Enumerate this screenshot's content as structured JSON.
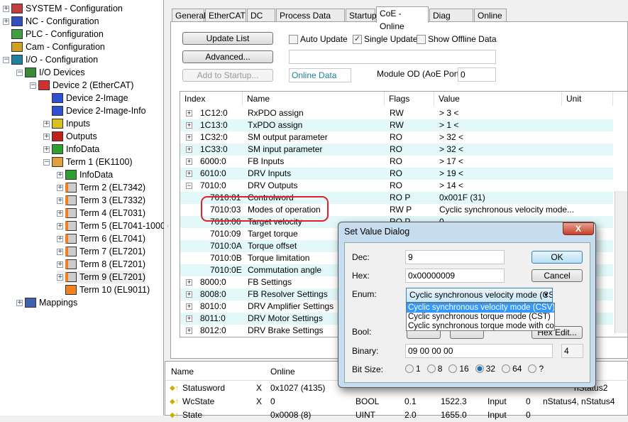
{
  "tree": [
    {
      "label": "SYSTEM - Configuration",
      "toggle": "+",
      "depth": 0,
      "icon": "system-icon"
    },
    {
      "label": "NC - Configuration",
      "toggle": "+",
      "depth": 0,
      "icon": "nc-icon"
    },
    {
      "label": "PLC - Configuration",
      "toggle": "",
      "depth": 0,
      "icon": "plc-icon"
    },
    {
      "label": "Cam - Configuration",
      "toggle": "",
      "depth": 0,
      "icon": "cam-icon"
    },
    {
      "label": "I/O - Configuration",
      "toggle": "-",
      "depth": 0,
      "icon": "io-icon"
    },
    {
      "label": "I/O Devices",
      "toggle": "-",
      "depth": 1,
      "icon": "io-devices-icon"
    },
    {
      "label": "Device 2 (EtherCAT)",
      "toggle": "-",
      "depth": 2,
      "icon": "ethercat-device-icon"
    },
    {
      "label": "Device 2-Image",
      "toggle": "",
      "depth": 3,
      "icon": "image-icon"
    },
    {
      "label": "Device 2-Image-Info",
      "toggle": "",
      "depth": 3,
      "icon": "image-icon"
    },
    {
      "label": "Inputs",
      "toggle": "+",
      "depth": 3,
      "icon": "inputs-icon"
    },
    {
      "label": "Outputs",
      "toggle": "+",
      "depth": 3,
      "icon": "outputs-icon"
    },
    {
      "label": "InfoData",
      "toggle": "+",
      "depth": 3,
      "icon": "infodata-icon"
    },
    {
      "label": "Term 1 (EK1100)",
      "toggle": "-",
      "depth": 3,
      "icon": "coupler-icon"
    },
    {
      "label": "InfoData",
      "toggle": "+",
      "depth": 4,
      "icon": "infodata-icon"
    },
    {
      "label": "Term 2 (EL7342)",
      "toggle": "+",
      "depth": 4,
      "icon": "terminal-icon"
    },
    {
      "label": "Term 3 (EL7332)",
      "toggle": "+",
      "depth": 4,
      "icon": "terminal-icon"
    },
    {
      "label": "Term 4 (EL7031)",
      "toggle": "+",
      "depth": 4,
      "icon": "terminal-icon"
    },
    {
      "label": "Term 5 (EL7041-1000)",
      "toggle": "+",
      "depth": 4,
      "icon": "terminal-icon"
    },
    {
      "label": "Term 6 (EL7041)",
      "toggle": "+",
      "depth": 4,
      "icon": "terminal-icon"
    },
    {
      "label": "Term 7 (EL7201)",
      "toggle": "+",
      "depth": 4,
      "icon": "terminal-icon"
    },
    {
      "label": "Term 8 (EL7201)",
      "toggle": "+",
      "depth": 4,
      "icon": "terminal-icon"
    },
    {
      "label": "Term 9 (EL7201)",
      "toggle": "+",
      "depth": 4,
      "icon": "terminal-icon",
      "selected": true
    },
    {
      "label": "Term 10 (EL9011)",
      "toggle": "",
      "depth": 4,
      "icon": "end-terminal-icon"
    },
    {
      "label": "Mappings",
      "toggle": "+",
      "depth": 1,
      "icon": "mappings-icon"
    }
  ],
  "tabs": [
    "General",
    "EtherCAT",
    "DC",
    "Process Data",
    "Startup",
    "CoE - Online",
    "Diag History",
    "Online"
  ],
  "active_tab": "CoE - Online",
  "coe": {
    "update_list": "Update List",
    "advanced": "Advanced...",
    "add_to_startup": "Add to Startup...",
    "auto_update": "Auto Update",
    "auto_update_checked": false,
    "single_update": "Single Update",
    "single_update_checked": true,
    "show_offline": "Show Offline Data",
    "show_offline_checked": false,
    "online_data": "Online Data",
    "module_od_label": "Module OD (AoE Port):",
    "module_od_value": "0",
    "columns": [
      "Index",
      "Name",
      "Flags",
      "Value",
      "Unit"
    ],
    "rows": [
      {
        "index": "1C12:0",
        "name": "RxPDO assign",
        "flags": "RW",
        "value": "> 3 <",
        "toggle": "+"
      },
      {
        "index": "1C13:0",
        "name": "TxPDO assign",
        "flags": "RW",
        "value": "> 1 <",
        "toggle": "+"
      },
      {
        "index": "1C32:0",
        "name": "SM output parameter",
        "flags": "RO",
        "value": "> 32 <",
        "toggle": "+"
      },
      {
        "index": "1C33:0",
        "name": "SM input parameter",
        "flags": "RO",
        "value": "> 32 <",
        "toggle": "+"
      },
      {
        "index": "6000:0",
        "name": "FB Inputs",
        "flags": "RO",
        "value": "> 17 <",
        "toggle": "+"
      },
      {
        "index": "6010:0",
        "name": "DRV Inputs",
        "flags": "RO",
        "value": "> 19 <",
        "toggle": "+"
      },
      {
        "index": "7010:0",
        "name": "DRV Outputs",
        "flags": "RO",
        "value": "> 14 <",
        "toggle": "-"
      },
      {
        "index": "7010:01",
        "name": "Controlword",
        "flags": "RO P",
        "value": "0x001F (31)",
        "child": true
      },
      {
        "index": "7010:03",
        "name": "Modes of operation",
        "flags": "RW P",
        "value": "Cyclic synchronous velocity mode...",
        "child": true
      },
      {
        "index": "7010:06",
        "name": "Target velocity",
        "flags": "RO P",
        "value": "0",
        "child": true
      },
      {
        "index": "7010:09",
        "name": "Target torque",
        "flags": "",
        "value": "",
        "child": true
      },
      {
        "index": "7010:0A",
        "name": "Torque offset",
        "flags": "",
        "value": "",
        "child": true
      },
      {
        "index": "7010:0B",
        "name": "Torque limitation",
        "flags": "",
        "value": "",
        "child": true
      },
      {
        "index": "7010:0E",
        "name": "Commutation angle",
        "flags": "",
        "value": "",
        "child": true
      },
      {
        "index": "8000:0",
        "name": "FB Settings",
        "flags": "",
        "value": "",
        "toggle": "+"
      },
      {
        "index": "8008:0",
        "name": "FB Resolver Settings",
        "flags": "",
        "value": "",
        "toggle": "+"
      },
      {
        "index": "8010:0",
        "name": "DRV Amplifier Settings",
        "flags": "",
        "value": "",
        "toggle": "+"
      },
      {
        "index": "8011:0",
        "name": "DRV Motor Settings",
        "flags": "",
        "value": "",
        "toggle": "+"
      },
      {
        "index": "8012:0",
        "name": "DRV Brake Settings",
        "flags": "",
        "value": "",
        "toggle": "+"
      }
    ],
    "highlight_color": "#e0202a"
  },
  "vars": {
    "columns": [
      "Name",
      "Online"
    ],
    "rows": [
      {
        "name": "Statusword",
        "x": "X",
        "online": "0x1027 (4135)",
        "type": "",
        "size": "",
        "addr": "",
        "io": "",
        "user": "",
        "linked": "nStatus2"
      },
      {
        "name": "WcState",
        "x": "X",
        "online": "0",
        "type": "BOOL",
        "size": "0.1",
        "addr": "1522.3",
        "io": "Input",
        "user": "0",
        "linked": "nStatus4, nStatus4"
      },
      {
        "name": "State",
        "x": "",
        "online": "0x0008 (8)",
        "type": "UINT",
        "size": "2.0",
        "addr": "1655.0",
        "io": "Input",
        "user": "0",
        "linked": ""
      }
    ]
  },
  "dialog": {
    "title": "Set Value Dialog",
    "close": "X",
    "dec_label": "Dec:",
    "dec": "9",
    "hex_label": "Hex:",
    "hex": "0x00000009",
    "ok": "OK",
    "cancel": "Cancel",
    "enum_label": "Enum:",
    "enum_value": "Cyclic synchronous velocity mode (CSV",
    "enum_options": [
      "Cyclic synchronous velocity mode (CSV)",
      "Cyclic synchronous torque mode (CST)",
      "Cyclic synchronous torque mode with comm"
    ],
    "bool_label": "Bool:",
    "hex_edit": "Hex Edit...",
    "binary_label": "Binary:",
    "binary": "09 00 00 00",
    "binary_len": "4",
    "bitsize_label": "Bit Size:",
    "bitsizes": [
      "1",
      "8",
      "16",
      "32",
      "64",
      "?"
    ],
    "bitsize_selected": "32"
  }
}
